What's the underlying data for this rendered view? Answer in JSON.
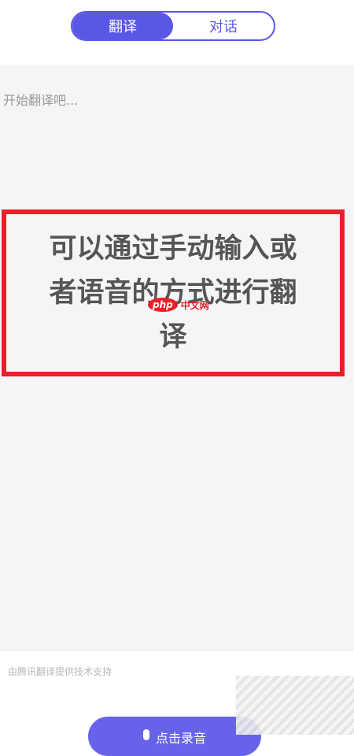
{
  "tabs": [
    {
      "label": "翻译",
      "active": true
    },
    {
      "label": "对话",
      "active": false
    }
  ],
  "input": {
    "placeholder": "开始翻译吧...",
    "value": ""
  },
  "callout": {
    "text": "可以通过手动输入或者语音的方式进行翻译"
  },
  "watermark": {
    "logo": "php",
    "site": "中文网"
  },
  "footer": {
    "provider_text": "由腾讯翻译提供技术支持"
  },
  "voice_button": {
    "label": "点击录音"
  },
  "colors": {
    "accent": "#5a57e6",
    "callout_border": "#e8202a",
    "panel_bg": "#f5f5f7"
  }
}
